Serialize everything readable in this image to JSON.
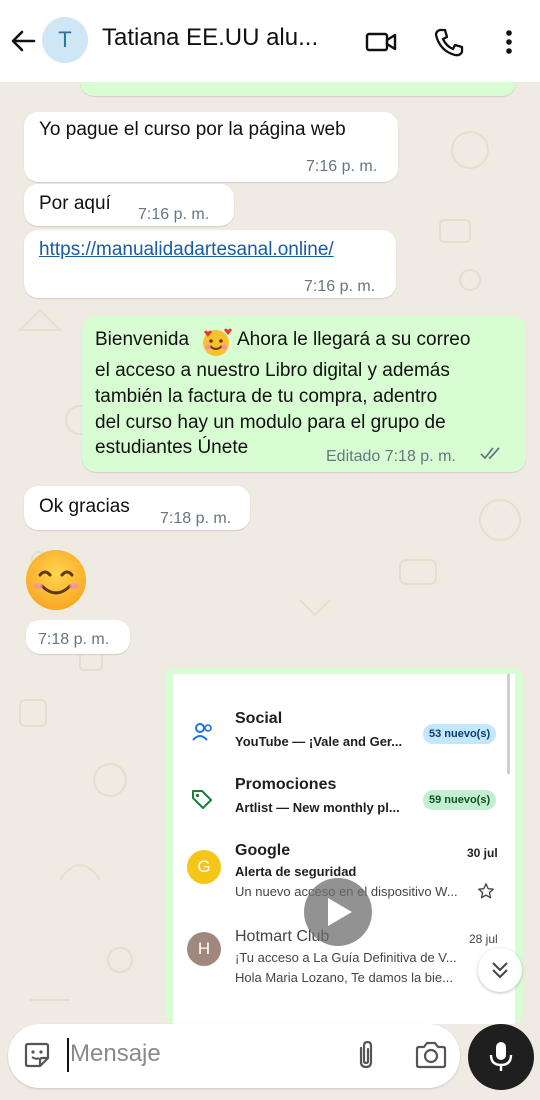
{
  "header": {
    "avatar_letter": "T",
    "contact_name": "Tatiana EE.UU alu...",
    "icons": [
      "back-arrow-icon",
      "video-call-icon",
      "phone-icon",
      "more-vert-icon"
    ]
  },
  "messages": [
    {
      "direction": "incoming",
      "text": "Yo pague el curso por la página web",
      "time": "7:16 p. m."
    },
    {
      "direction": "incoming",
      "text": "Por aquí",
      "time": "7:16 p. m."
    },
    {
      "direction": "incoming",
      "text": "https://manualidadartesanal.online/",
      "time": "7:16 p. m.",
      "is_link": true
    },
    {
      "direction": "outgoing",
      "lines": [
        "Bienvenida",
        "Ahora le llegará a su correo",
        "el acceso a nuestro Libro digital y además",
        "también la factura de tu compra, adentro",
        "del curso hay un modulo para el grupo de",
        "estudiantes Únete"
      ],
      "status": "Editado 7:18 p. m.",
      "read_receipt": "double-check-icon"
    },
    {
      "direction": "incoming",
      "text": "Ok gracias",
      "time": "7:18 p. m."
    },
    {
      "direction": "incoming",
      "emoji": "smiling-face-icon",
      "time": "7:18 p. m."
    }
  ],
  "media": {
    "type": "video",
    "rows": [
      {
        "icon": "people-icon",
        "title": "Social",
        "sub": "YouTube — ¡Vale and Ger...",
        "badge": "53 nuevo(s)",
        "badge_color": "#c2e7ff"
      },
      {
        "icon": "tag-icon",
        "title": "Promociones",
        "sub": "Artlist — New monthly pl...",
        "badge": "59 nuevo(s)",
        "badge_color": "#c4eed0"
      },
      {
        "avatar_letter": "G",
        "avatar_color": "#f5c518",
        "title": "Google",
        "date": "30 jul",
        "sub": "Alerta de seguridad",
        "sub2": "Un nuevo acceso en el dispositivo W..."
      },
      {
        "avatar_letter": "H",
        "avatar_color": "#a1887f",
        "title": "Hotmart Club",
        "date": "28 jul",
        "sub": "¡Tu acceso a La Guía Definitiva de V...",
        "sub2": "Hola Maria Lozano, Te damos la bie..."
      }
    ]
  },
  "composer": {
    "placeholder": "Mensaje",
    "icons": [
      "sticker-icon",
      "attach-icon",
      "camera-icon",
      "mic-icon"
    ]
  },
  "colors": {
    "incoming": "#ffffff",
    "outgoing": "#d9fdd3",
    "background": "#efeae2",
    "link": "#1a5ba6"
  }
}
